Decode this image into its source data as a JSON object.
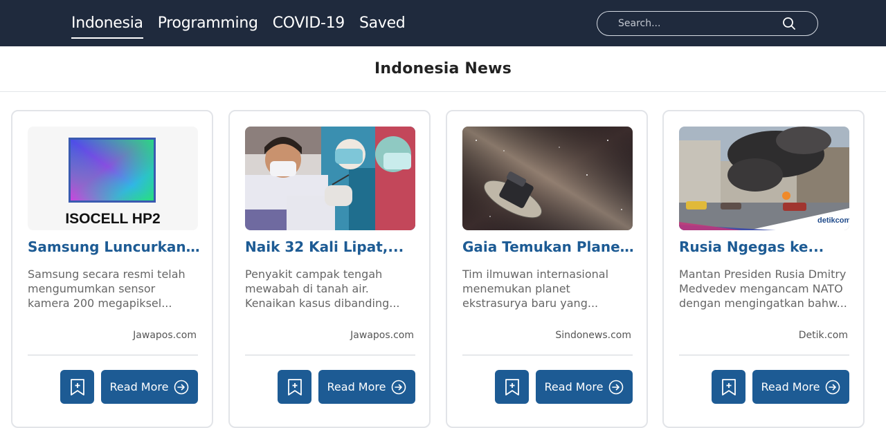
{
  "nav": {
    "links": [
      {
        "label": "Indonesia",
        "active": true
      },
      {
        "label": "Programming",
        "active": false
      },
      {
        "label": "COVID-19",
        "active": false
      },
      {
        "label": "Saved",
        "active": false
      }
    ],
    "search_placeholder": "Search...",
    "search_icon": "search-icon"
  },
  "page": {
    "title": "Indonesia News"
  },
  "cards": [
    {
      "title": "Samsung Luncurkan...",
      "desc_lines": [
        "Samsung secara resmi telah",
        "mengumumkan sensor",
        "kamera 200 megapiksel..."
      ],
      "source": "Jawapos.com",
      "image_label": "ISOCELL HP2",
      "read_more": "Read More"
    },
    {
      "title": "Naik 32 Kali Lipat,...",
      "desc_lines": [
        "Penyakit campak tengah",
        "mewabah di tanah air.",
        "Kenaikan kasus dibanding..."
      ],
      "source": "Jawapos.com",
      "read_more": "Read More"
    },
    {
      "title": "Gaia Temukan Plane...",
      "desc_lines": [
        "Tim ilmuwan internasional",
        "menemukan planet",
        "ekstrasurya baru yang..."
      ],
      "source": "Sindonews.com",
      "read_more": "Read More"
    },
    {
      "title": "Rusia Ngegas ke...",
      "desc_lines": [
        "Mantan Presiden Rusia Dmitry",
        "Medvedev mengancam NATO",
        "dengan mengingatkan bahw..."
      ],
      "source": "Detik.com",
      "image_label": "detikcom",
      "read_more": "Read More"
    }
  ],
  "colors": {
    "navbar": "#1f2a3d",
    "accent": "#1d5b94"
  }
}
